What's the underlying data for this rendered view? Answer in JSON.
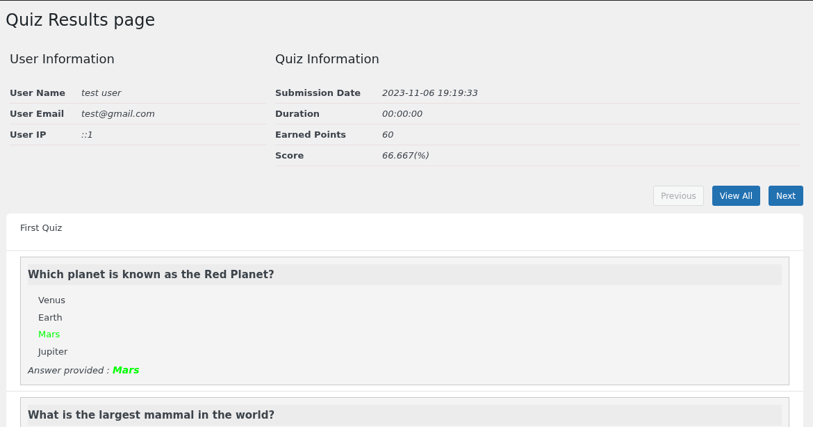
{
  "title": "Quiz Results page",
  "user_info": {
    "heading": "User Information",
    "rows": [
      {
        "label": "User Name",
        "value": "test user"
      },
      {
        "label": "User Email",
        "value": "test@gmail.com"
      },
      {
        "label": "User IP",
        "value": "::1"
      }
    ]
  },
  "quiz_info": {
    "heading": "Quiz Information",
    "rows": [
      {
        "label": "Submission Date",
        "value": "2023-11-06 19:19:33"
      },
      {
        "label": "Duration",
        "value": "00:00:00"
      },
      {
        "label": "Earned Points",
        "value": "60"
      },
      {
        "label": "Score",
        "value": "66.667(%)"
      }
    ]
  },
  "buttons": [
    {
      "label": "Previous",
      "disabled": true
    },
    {
      "label": "View All",
      "disabled": false
    },
    {
      "label": "Next",
      "disabled": false
    }
  ],
  "quiz": {
    "title": "First Quiz",
    "questions": [
      {
        "question": "Which planet is known as the Red Planet?",
        "options": [
          {
            "text": "Venus",
            "correct": false
          },
          {
            "text": "Earth",
            "correct": false
          },
          {
            "text": "Mars",
            "correct": true
          },
          {
            "text": "Jupiter",
            "correct": false
          }
        ],
        "answer_label": "Answer provided :",
        "answer": "Mars"
      },
      {
        "question": "What is the largest mammal in the world?"
      }
    ]
  }
}
